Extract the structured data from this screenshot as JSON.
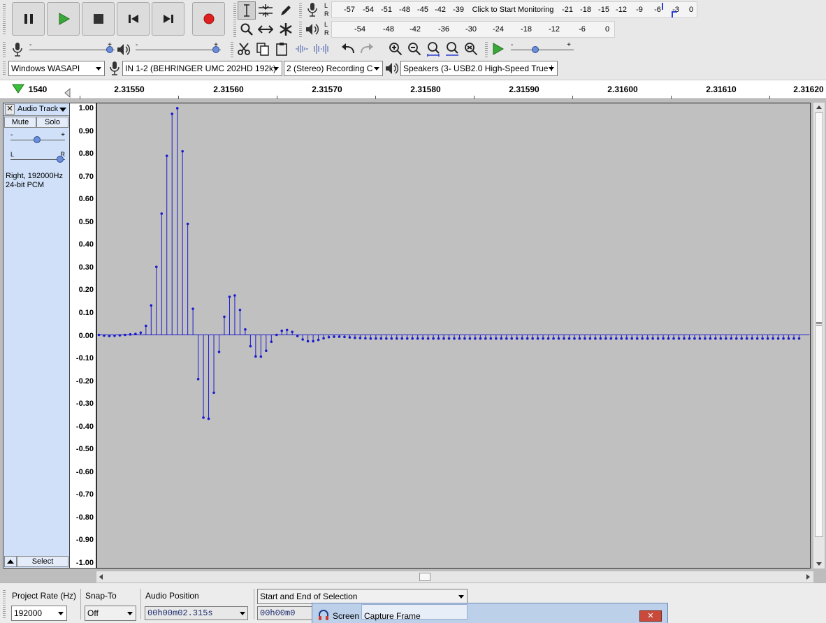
{
  "transport": {
    "pause_icon": "pause-icon",
    "play_icon": "play-icon",
    "stop_icon": "stop-icon",
    "skip_start_icon": "skip-to-start-icon",
    "skip_end_icon": "skip-to-end-icon",
    "record_icon": "record-icon",
    "record_color": "#e02020",
    "play_color": "#39a839"
  },
  "record_meter": {
    "l": "L",
    "r": "R",
    "ticks": [
      "-57",
      "-54",
      "-51",
      "-48",
      "-45",
      "-42",
      "-39",
      "-21",
      "-18",
      "-15",
      "-12",
      "-9",
      "-6",
      "-3",
      "0"
    ],
    "monitor_text": "Click to Start Monitoring"
  },
  "playback_meter": {
    "l": "L",
    "r": "R",
    "ticks": [
      "-54",
      "-48",
      "-42",
      "-36",
      "-30",
      "-24",
      "-18",
      "-12",
      "-6",
      "0"
    ]
  },
  "mixer": {
    "rec_minus": "-",
    "rec_plus": "+",
    "play_minus": "-",
    "play_plus": "+",
    "rec_level": 1.0,
    "play_level": 1.0
  },
  "play_at_speed": {
    "minus": "-",
    "plus": "+",
    "speed_level": 0.38
  },
  "devices": {
    "host": "Windows WASAPI",
    "recording_device": "IN 1-2 (BEHRINGER UMC 202HD 192k)",
    "channels": "2 (Stereo) Recording C",
    "playback_device": "Speakers (3- USB2.0 High-Speed True I"
  },
  "ruler": {
    "labels": [
      "1540",
      "2.31550",
      "2.31560",
      "2.31570",
      "2.31580",
      "2.31590",
      "2.31600",
      "2.31610",
      "2.31620"
    ]
  },
  "track": {
    "name": "Audio Track",
    "close": "✕",
    "mute": "Mute",
    "solo": "Solo",
    "gain_minus": "-",
    "gain_plus": "+",
    "pan_left": "L",
    "pan_right": "R",
    "info_line1": "Right, 192000Hz",
    "info_line2": "24-bit PCM",
    "select": "Select",
    "gain_level": 0.5,
    "pan_level": 1.0
  },
  "chart_data": {
    "type": "stem",
    "ylim": [
      -1.0,
      1.0
    ],
    "yticks": [
      "1.00",
      "0.90",
      "0.80",
      "0.70",
      "0.60",
      "0.50",
      "0.40",
      "0.30",
      "0.20",
      "0.10",
      "0.00",
      "-0.10",
      "-0.20",
      "-0.30",
      "-0.40",
      "-0.50",
      "-0.60",
      "-0.70",
      "-0.80",
      "-0.90",
      "-1.00"
    ],
    "series": [
      {
        "color": "#1a1acc",
        "values": [
          0.0,
          -0.003,
          -0.005,
          -0.004,
          -0.002,
          0.0,
          0.002,
          0.004,
          0.01,
          0.04,
          0.13,
          0.3,
          0.535,
          0.79,
          0.975,
          1.0,
          0.81,
          0.49,
          0.115,
          -0.195,
          -0.365,
          -0.37,
          -0.255,
          -0.075,
          0.08,
          0.168,
          0.174,
          0.11,
          0.024,
          -0.05,
          -0.095,
          -0.096,
          -0.07,
          -0.03,
          0.0,
          0.018,
          0.022,
          0.013,
          -0.005,
          -0.02,
          -0.028,
          -0.028,
          -0.022,
          -0.015,
          -0.01,
          -0.008,
          -0.008,
          -0.009,
          -0.011,
          -0.013,
          -0.014,
          -0.015,
          -0.016,
          -0.016,
          -0.016,
          -0.016,
          -0.016,
          -0.016,
          -0.016,
          -0.016,
          -0.016,
          -0.016,
          -0.016,
          -0.016,
          -0.016,
          -0.016,
          -0.016,
          -0.016,
          -0.016,
          -0.016,
          -0.016,
          -0.016,
          -0.016,
          -0.016,
          -0.016,
          -0.016,
          -0.016,
          -0.016,
          -0.016,
          -0.016,
          -0.016,
          -0.016,
          -0.016,
          -0.016,
          -0.016,
          -0.016,
          -0.016,
          -0.016,
          -0.016,
          -0.016,
          -0.016,
          -0.016,
          -0.016,
          -0.016,
          -0.016,
          -0.016,
          -0.016,
          -0.016,
          -0.016,
          -0.016,
          -0.016,
          -0.016,
          -0.016,
          -0.016,
          -0.016,
          -0.016,
          -0.016,
          -0.016,
          -0.016,
          -0.016,
          -0.016,
          -0.016,
          -0.016,
          -0.016,
          -0.016,
          -0.016,
          -0.016,
          -0.016,
          -0.016,
          -0.016,
          -0.016,
          -0.016,
          -0.016,
          -0.016,
          -0.016,
          -0.016,
          -0.016,
          -0.016,
          -0.016,
          -0.016,
          -0.016,
          -0.016,
          -0.016,
          -0.016,
          -0.016
        ]
      }
    ]
  },
  "selection_toolbar": {
    "project_rate_label": "Project Rate (Hz)",
    "project_rate_value": "192000",
    "snap_to_label": "Snap-To",
    "snap_to_value": "Off",
    "audio_position_label": "Audio Position",
    "audio_position_value": "00h00m02.315s",
    "selection_mode": "Start and End of Selection",
    "selection_start_value": "00h00m0"
  },
  "capture_frame": {
    "title_screen": "Screen",
    "title_rest": "Capture Frame",
    "close": "✕"
  }
}
